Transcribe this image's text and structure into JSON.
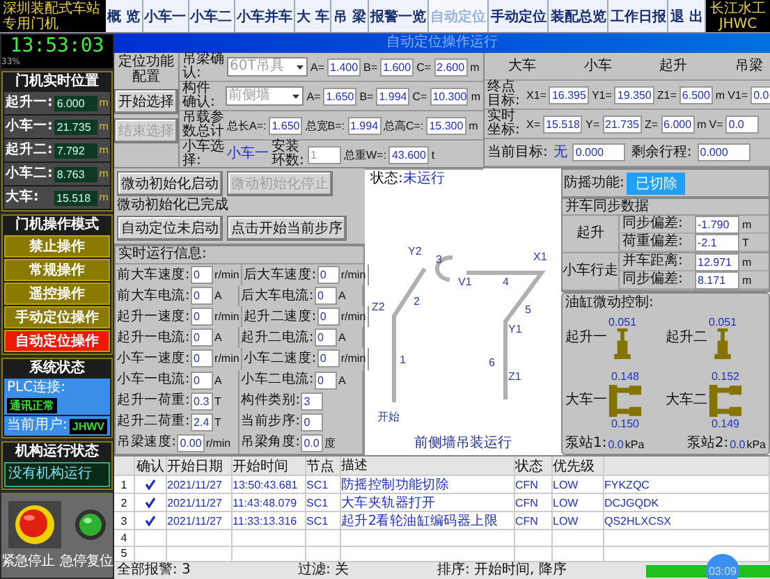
{
  "header": {
    "logo_lines": [
      "深圳装配式车站",
      "专用门机"
    ],
    "brand_lines": [
      "长江水工",
      "JHWC"
    ]
  },
  "tabs": [
    {
      "label": "概 览",
      "selected": false
    },
    {
      "label": "小车一",
      "selected": false
    },
    {
      "label": "小车二",
      "selected": false
    },
    {
      "label": "小车并车",
      "selected": false
    },
    {
      "label": "大 车",
      "selected": false
    },
    {
      "label": "吊 梁",
      "selected": false
    },
    {
      "label": "报警一览",
      "selected": false
    },
    {
      "label": "自动定位",
      "selected": true
    },
    {
      "label": "手动定位",
      "selected": false
    },
    {
      "label": "装配总览",
      "selected": false
    },
    {
      "label": "工作日报",
      "selected": false
    },
    {
      "label": "退 出",
      "selected": false
    }
  ],
  "clock": {
    "time": "13:53:03",
    "caption": "33%"
  },
  "positions": {
    "title": "门机实时位置",
    "items": [
      {
        "label": "起升一:",
        "value": "6.000",
        "unit": "m"
      },
      {
        "label": "小车一:",
        "value": "21.735",
        "unit": "m"
      },
      {
        "label": "起升二:",
        "value": "7.792",
        "unit": "m"
      },
      {
        "label": "小车二:",
        "value": "8.763",
        "unit": "m"
      },
      {
        "label": "大车:",
        "value": "15.518",
        "unit": "m"
      }
    ]
  },
  "modes": {
    "title": "门机操作模式",
    "items": [
      {
        "label": "禁止操作",
        "selected": false
      },
      {
        "label": "常规操作",
        "selected": false
      },
      {
        "label": "遥控操作",
        "selected": false
      },
      {
        "label": "手动定位操作",
        "selected": false
      },
      {
        "label": "自动定位操作",
        "selected": true
      }
    ]
  },
  "system": {
    "title": "系统状态",
    "rows": [
      {
        "label": "PLC连接:",
        "value": "通讯正常"
      },
      {
        "label": "当前用户:",
        "value": "JHWV"
      }
    ]
  },
  "mechanism": {
    "title": "机构运行状态",
    "value": "没有机构运行"
  },
  "estop": {
    "stop_label": "紧急停止",
    "reset_label": "急停复位"
  },
  "page_title": "自动定位操作运行",
  "config": {
    "title": "定位功能配置",
    "start_button": {
      "label": "开始选择",
      "disabled": false
    },
    "end_button": {
      "label": "结束选择",
      "disabled": true
    },
    "rows": [
      {
        "kind": "select",
        "label": "吊梁确认:",
        "value": "60T吊具",
        "disabled": true,
        "params": [
          {
            "name": "A=",
            "value": "1.400"
          },
          {
            "name": "B=",
            "value": "1.600"
          },
          {
            "name": "C=",
            "value": "2.600"
          }
        ],
        "unit": "m"
      },
      {
        "kind": "select",
        "label": "构件确认:",
        "value": "前侧墙",
        "disabled": true,
        "params": [
          {
            "name": "A=",
            "value": "1.650"
          },
          {
            "name": "B=",
            "value": "1.994"
          },
          {
            "name": "C=",
            "value": "10.300"
          }
        ],
        "unit": "m"
      },
      {
        "kind": "totals",
        "label": "吊载参数总计",
        "params": [
          {
            "name": "总长A=:",
            "value": "1.650"
          },
          {
            "name": "总宽B=:",
            "value": "1.994"
          },
          {
            "name": "总高C=:",
            "value": "15.300"
          }
        ],
        "unit": "m"
      },
      {
        "kind": "trolley",
        "label": "小车选择:",
        "value": "小车一",
        "ring_label": "安装环数:",
        "ring_value": "1",
        "params": [
          {
            "name": "总重W=:",
            "value": "43.600"
          }
        ],
        "unit": "t"
      }
    ]
  },
  "targets": {
    "headers": [
      "大车",
      "小车",
      "起升",
      "吊梁"
    ],
    "rows": [
      {
        "label": "终点目标:",
        "values": [
          {
            "name": "X1=",
            "value": "16.395"
          },
          {
            "name": "Y1=",
            "value": "19.350"
          },
          {
            "name": "Z1=",
            "value": "6.500"
          },
          {
            "name": "V1=",
            "value": "0.0"
          }
        ],
        "unit": "m"
      },
      {
        "label": "实时坐标:",
        "values": [
          {
            "name": "X=",
            "value": "15.518"
          },
          {
            "name": "Y=",
            "value": "21.735"
          },
          {
            "name": "Z=",
            "value": "6.000"
          },
          {
            "name": "V=",
            "value": "0.0"
          }
        ],
        "unit": "m"
      }
    ],
    "current_label": "当前目标:",
    "current_value": "无",
    "current_distance": "0.000",
    "remaining_label": "剩余行程:",
    "remaining_value": "0.000"
  },
  "micro": {
    "buttons": [
      {
        "label": "微动初始化启动",
        "disabled": false
      },
      {
        "label": "微动初始化停止",
        "disabled": true
      }
    ],
    "status": "微动初始化已完成",
    "buttons2": [
      {
        "label": "自动定位未启动",
        "disabled": false
      },
      {
        "label": "点击开始当前步序",
        "disabled": false
      }
    ]
  },
  "realtime": {
    "title": "实时运行信息:",
    "rows": [
      [
        {
          "label": "前大车速度:",
          "value": "0",
          "unit": "r/min"
        },
        {
          "label": "后大车速度:",
          "value": "0",
          "unit": "r/min"
        }
      ],
      [
        {
          "label": "前大车电流:",
          "value": "0",
          "unit": "A"
        },
        {
          "label": "后大车电流:",
          "value": "0",
          "unit": "A"
        }
      ],
      [
        {
          "label": "起升一速度:",
          "value": "0",
          "unit": "r/min"
        },
        {
          "label": "起升二速度:",
          "value": "0",
          "unit": "r/min"
        }
      ],
      [
        {
          "label": "起升一电流:",
          "value": "0",
          "unit": "A"
        },
        {
          "label": "起升二电流:",
          "value": "0",
          "unit": "A"
        }
      ],
      [
        {
          "label": "小车一速度:",
          "value": "0",
          "unit": "r/min"
        },
        {
          "label": "小车二速度:",
          "value": "0",
          "unit": "r/min"
        }
      ],
      [
        {
          "label": "小车一电流:",
          "value": "0",
          "unit": "A"
        },
        {
          "label": "小车二电流:",
          "value": "0",
          "unit": "A"
        }
      ],
      [
        {
          "label": "起升一荷重:",
          "value": "0.3",
          "unit": "T"
        },
        {
          "label": "构件类别:",
          "value": "3"
        }
      ],
      [
        {
          "label": "起升二荷重:",
          "value": "2.4",
          "unit": "T"
        },
        {
          "label": "当前步序:",
          "value": "0"
        }
      ],
      [
        {
          "label": "吊梁速度:",
          "value": "0.00",
          "unit": "r/min"
        },
        {
          "label": "吊梁角度:",
          "value": "0.0",
          "unit": "度"
        }
      ]
    ]
  },
  "run_status": {
    "label": "状态:",
    "value": "未运行"
  },
  "route": {
    "labels": [
      "开始",
      "1",
      "Z2",
      "2",
      "Y2",
      "3",
      "V1",
      "4",
      "X1",
      "5",
      "Y1",
      "6",
      "Z1"
    ],
    "caption": "前侧墙吊装运行"
  },
  "anti_sway": {
    "label": "防摇功能:",
    "value": "已切除"
  },
  "sync": {
    "title": "并车同步数据",
    "groups": [
      {
        "name": "起升",
        "rows": [
          {
            "label": "同步偏差:",
            "value": "-1.790",
            "unit": "m"
          },
          {
            "label": "荷重偏差:",
            "value": "-2.1",
            "unit": "T"
          }
        ]
      },
      {
        "name": "小车行走",
        "rows": [
          {
            "label": "并车距离:",
            "value": "12.971",
            "unit": "m"
          },
          {
            "label": "同步偏差:",
            "value": "8.171",
            "unit": "m"
          }
        ]
      }
    ]
  },
  "cylinders": {
    "title": "油缸微动控制:",
    "items": [
      {
        "kind": "lift",
        "label": "起升一",
        "values": [
          "0.051"
        ]
      },
      {
        "kind": "lift",
        "label": "起升二",
        "values": [
          "0.051"
        ]
      },
      {
        "kind": "travel",
        "label": "大车一",
        "values": [
          "0.148",
          "0.150"
        ]
      },
      {
        "kind": "travel",
        "label": "大车二",
        "values": [
          "0.152",
          "0.149"
        ]
      }
    ],
    "pumps": [
      {
        "label": "泵站1:",
        "value": "0.0",
        "unit": "kPa"
      },
      {
        "label": "泵站2:",
        "value": "0.0",
        "unit": "kPa"
      }
    ]
  },
  "alarms": {
    "columns": [
      "确认",
      "开始日期",
      "开始时间",
      "节点",
      "描述",
      "状态",
      "优先级"
    ],
    "rows": [
      {
        "no": "1",
        "confirmed": true,
        "date": "2021/11/27",
        "time": "13:50:43.681",
        "node": "SC1",
        "desc": "防摇控制功能切除",
        "status": "CFN",
        "priority": "LOW",
        "tag": "FYKZQC"
      },
      {
        "no": "2",
        "confirmed": true,
        "date": "2021/11/27",
        "time": "11:43:48.079",
        "node": "SC1",
        "desc": "大车夹轨器打开",
        "status": "CFN",
        "priority": "LOW",
        "tag": "DCJGQDK"
      },
      {
        "no": "3",
        "confirmed": true,
        "date": "2021/11/27",
        "time": "11:33:13.316",
        "node": "SC1",
        "desc": "起升2看轮油缸编码器上限",
        "status": "CFN",
        "priority": "LOW",
        "tag": "QS2HLXCSX"
      },
      {
        "no": "4",
        "confirmed": false
      },
      {
        "no": "5",
        "confirmed": false
      }
    ],
    "total": "全部报警: 3",
    "filter": "过滤: 关",
    "sort": "排序: 开始时间, 降序",
    "timer": "03:09",
    "timer_bar": {
      "level": 1
    }
  }
}
